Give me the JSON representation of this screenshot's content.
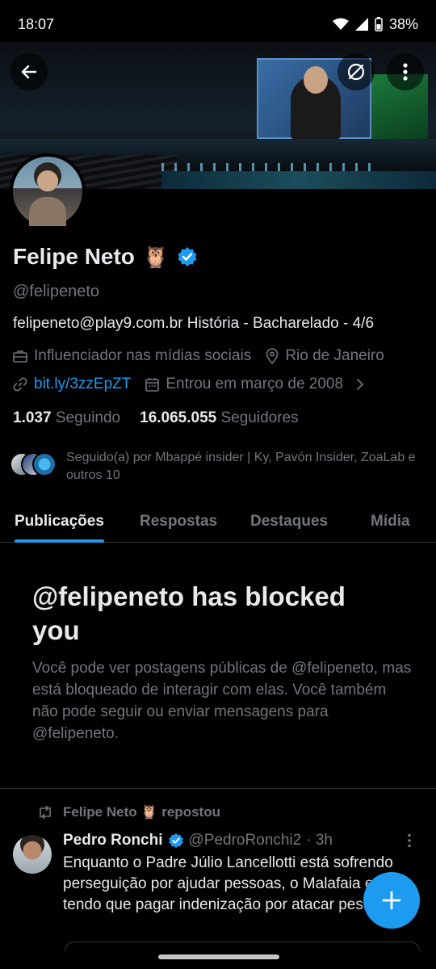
{
  "status_bar": {
    "time": "18:07",
    "battery": "38%"
  },
  "profile": {
    "name": "Felipe Neto",
    "emoji": "🦉",
    "handle": "@felipeneto",
    "bio": "felipeneto@play9.com.br História - Bacharelado - 4/6",
    "category": "Influenciador nas mídias sociais",
    "location": "Rio de Janeiro",
    "link": "bit.ly/3zzEpZT",
    "joined": "Entrou em março de 2008",
    "following_count": "1.037",
    "following_label": "Seguindo",
    "followers_count": "16.065.055",
    "followers_label": "Seguidores",
    "followed_by": "Seguido(a) por Mbappé insider | Ky, Pavón Insider, ZoaLab e outros 10"
  },
  "tabs": [
    {
      "label": "Publicações",
      "active": true
    },
    {
      "label": "Respostas",
      "active": false
    },
    {
      "label": "Destaques",
      "active": false
    },
    {
      "label": "Mídia",
      "active": false
    }
  ],
  "blocked": {
    "title": "@felipeneto has blocked you",
    "text": "Você pode ver postagens públicas de @felipeneto, mas está bloqueado de interagir com elas. Você também não pode seguir ou enviar mensagens para @felipeneto."
  },
  "post": {
    "repost_label": "Felipe Neto 🦉 repostou",
    "author": "Pedro Ronchi",
    "handle": "@PedroRonchi2",
    "time": "· 3h",
    "text": "Enquanto o Padre Júlio Lancellotti está sofrendo perseguição por ajudar pessoas, o Malafaia está tendo que pagar indenização por atacar pessoas."
  },
  "colors": {
    "accent": "#1d9bf0",
    "muted": "#71767b",
    "text": "#e7e9ea",
    "background": "#000000"
  },
  "icons": [
    "back-arrow-icon",
    "translate-off-icon",
    "more-vertical-icon",
    "briefcase-icon",
    "location-pin-icon",
    "link-icon",
    "calendar-icon",
    "chevron-right-icon",
    "verified-icon",
    "repost-icon",
    "plus-icon"
  ]
}
